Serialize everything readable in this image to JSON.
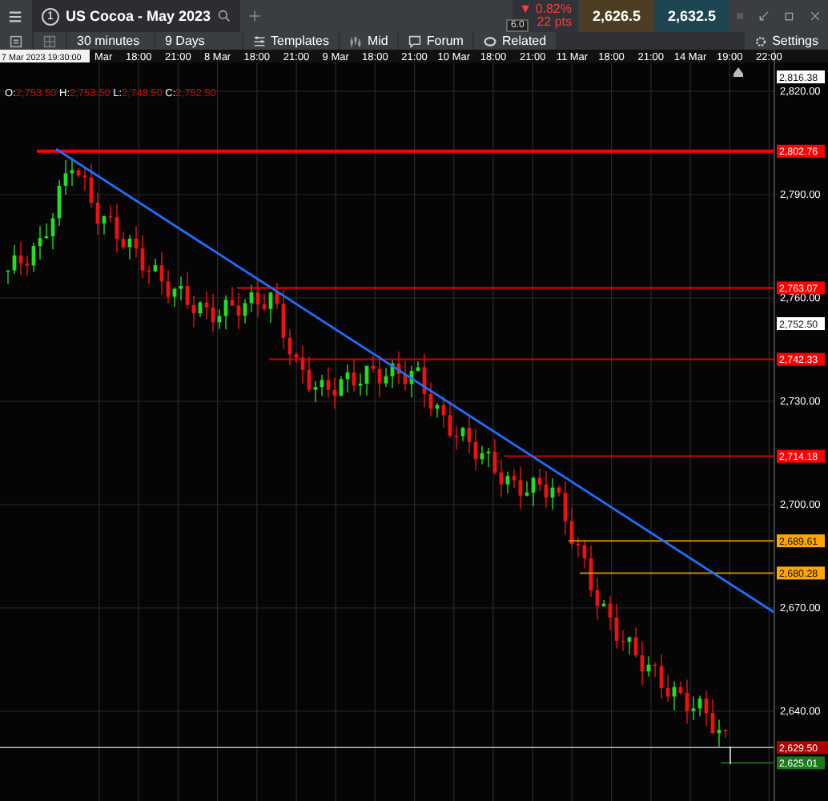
{
  "instrument_tab": {
    "number": "1",
    "title": "US Cocoa - May 2023"
  },
  "quote": {
    "arrow": "▼",
    "change_pct": "0.82%",
    "change_pts": "22 pts",
    "sell": "2,626.5",
    "buy": "2,632.5",
    "spread": "6.0"
  },
  "toolbar": [
    {
      "kind": "plain",
      "label": "30 minutes"
    },
    {
      "kind": "plain",
      "label": "9 Days"
    },
    {
      "kind": "templates",
      "label": "Templates"
    },
    {
      "kind": "mid",
      "label": "Mid"
    },
    {
      "kind": "forum",
      "label": "Forum"
    },
    {
      "kind": "related",
      "label": "Related"
    }
  ],
  "settings": {
    "label": "Settings"
  },
  "cursor_time": "7 Mar 2023 19:30:00",
  "time_labels": [
    "Mar",
    "18:00",
    "21:00",
    "8 Mar",
    "18:00",
    "21:00",
    "9 Mar",
    "18:00",
    "21:00",
    "10 Mar",
    "18:00",
    "21:00",
    "11 Mar",
    "18:00",
    "21:00",
    "14 Mar",
    "19:00",
    "22:00"
  ],
  "ohlc": [
    {
      "key": "O:",
      "value": "2,753.50"
    },
    {
      "key": "H:",
      "value": "2,753.50"
    },
    {
      "key": "L:",
      "value": "2,748.50"
    },
    {
      "key": "C:",
      "value": "2,752.50"
    }
  ],
  "price_ticks": [
    "2,820.00",
    "2,790.00",
    "2,760.00",
    "2,730.00",
    "2,700.00",
    "2,670.00",
    "2,640.00"
  ],
  "price_markers": [
    {
      "kind": "badge",
      "label": "2,816.38",
      "color": "#ffffff"
    },
    {
      "kind": "level",
      "label": "2,802.76",
      "color": "#ff0000"
    },
    {
      "kind": "level",
      "label": "2,763.07",
      "color": "#ff0000"
    },
    {
      "kind": "badge",
      "label": "2,752.50",
      "color": "#ffffff"
    },
    {
      "kind": "level",
      "label": "2,742.33",
      "color": "#ff0000"
    },
    {
      "kind": "level",
      "label": "2,714.18",
      "color": "#ff0000"
    },
    {
      "kind": "level",
      "label": "2,689.61",
      "color": "#ffa500"
    },
    {
      "kind": "level",
      "label": "2,680.28",
      "color": "#ffa500"
    },
    {
      "kind": "current",
      "label": "2,629.50",
      "color": "#b00000"
    },
    {
      "kind": "low",
      "label": "2,625.01",
      "color": "#1a7a1a"
    }
  ]
}
